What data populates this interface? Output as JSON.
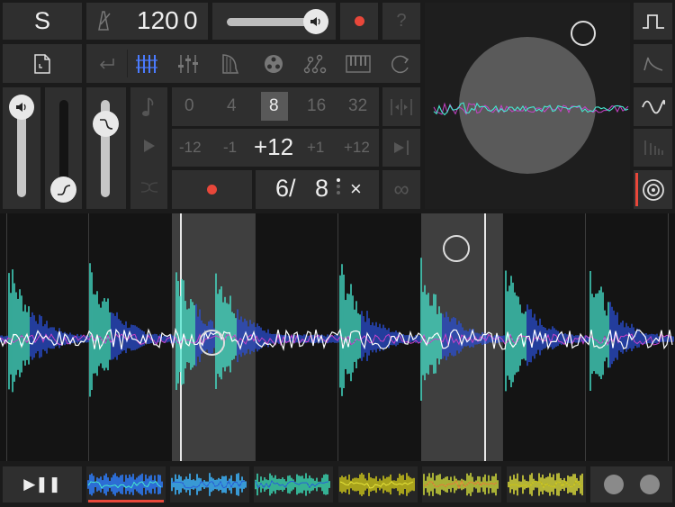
{
  "top": {
    "project_label": "S",
    "tempo_value": "120",
    "tempo_fraction": "0",
    "help_label": "?"
  },
  "steps": {
    "options": [
      "0",
      "4",
      "8",
      "16",
      "32"
    ],
    "selected": "8"
  },
  "transpose": {
    "options": [
      "-12",
      "-1",
      "+12",
      "+1",
      "+12"
    ],
    "main_value": "+12"
  },
  "time_signature": {
    "numerator": "6/",
    "denominator": "8",
    "close_label": "×",
    "infinity_label": "∞"
  },
  "transport": {
    "play_pause_label": "▶❚❚"
  },
  "clip_thumbnails": [
    {
      "color": "#2e7fff",
      "accent": "#46e8d0"
    },
    {
      "color": "#3db6ff",
      "accent": "#2a5fd6"
    },
    {
      "color": "#39d4b0",
      "accent": "#2a5fd6"
    },
    {
      "color": "#c8c21a",
      "accent": "#e5e23a"
    },
    {
      "color": "#c8d23a",
      "accent": "#e37d3a"
    },
    {
      "color": "#d8d83a",
      "accent": "#c8c21a"
    }
  ],
  "colors": {
    "accent_red": "#e8473a",
    "wave_cyan": "#46e8d0",
    "wave_blue": "#2a4fd6",
    "wave_white": "#ffffff",
    "wave_magenta": "#c842c8"
  }
}
